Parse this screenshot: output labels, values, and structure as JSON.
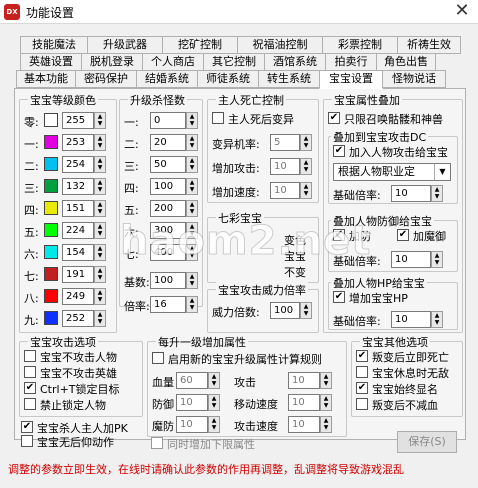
{
  "window": {
    "title": "功能设置",
    "icon_text": "DX",
    "close_glyph": "✕"
  },
  "tabs_row1": [
    "技能魔法",
    "升级武器",
    "挖矿控制",
    "祝福油控制",
    "彩票控制",
    "祈祷生效"
  ],
  "tabs_row2": [
    "英雄设置",
    "脱机登录",
    "个人商店",
    "其它控制",
    "酒馆系统",
    "拍卖行",
    "角色出售"
  ],
  "tabs_row3": [
    "基本功能",
    "密码保护",
    "结婚系统",
    "师徒系统",
    "转生系统",
    "宝宝设置",
    "怪物说话"
  ],
  "active_tab": "宝宝设置",
  "colors": {
    "title": "宝宝等级颜色",
    "rows": [
      {
        "label": "零:",
        "value": "255",
        "swatch": "#ffffff"
      },
      {
        "label": "一:",
        "value": "253",
        "swatch": "#e000e0"
      },
      {
        "label": "二:",
        "value": "254",
        "swatch": "#00c0f0"
      },
      {
        "label": "三:",
        "value": "132",
        "swatch": "#00a040"
      },
      {
        "label": "四:",
        "value": "151",
        "swatch": "#e8e800"
      },
      {
        "label": "五:",
        "value": "224",
        "swatch": "#00ff00"
      },
      {
        "label": "六:",
        "value": "154",
        "swatch": "#00e8e8"
      },
      {
        "label": "七:",
        "value": "191",
        "swatch": "#c02020"
      },
      {
        "label": "八:",
        "value": "249",
        "swatch": "#ff0000"
      },
      {
        "label": "九:",
        "value": "252",
        "swatch": "#1030ff"
      }
    ]
  },
  "upgrade": {
    "title": "升级杀怪数",
    "rows": [
      {
        "label": "一:",
        "value": "0"
      },
      {
        "label": "二:",
        "value": "20"
      },
      {
        "label": "三:",
        "value": "50"
      },
      {
        "label": "四:",
        "value": "100"
      },
      {
        "label": "五:",
        "value": "200"
      },
      {
        "label": "六:",
        "value": "300"
      },
      {
        "label": "七:",
        "value": "400"
      }
    ],
    "base_label": "基数:",
    "base_value": "100",
    "ratio_label": "倍率:",
    "ratio_value": "16"
  },
  "death": {
    "title": "主人死亡控制",
    "checkbox": "主人死后变异",
    "rate_label": "变异机率:",
    "rate_value": "5",
    "attack_label": "增加攻击:",
    "attack_value": "10",
    "speed_label": "增加速度:",
    "speed_value": "10"
  },
  "rainbow": {
    "title": "七彩宝宝",
    "line1": "变色",
    "line2": "宝宝",
    "line3": "不变"
  },
  "power": {
    "title": "宝宝攻击威力倍率",
    "label": "威力倍数:",
    "value": "100"
  },
  "attr": {
    "title": "宝宝属性叠加",
    "summon_only": "只限召唤骷髅和神兽",
    "dc": {
      "title": "叠加到宝宝攻击DC",
      "checkbox": "加入人物攻击给宝宝",
      "select": "根据人物职业定",
      "base_label": "基础倍率:",
      "base_value": "10"
    },
    "def": {
      "title": "叠加人物防御给宝宝",
      "cb1": "加防",
      "cb2": "加魔御",
      "base_label": "基础倍率:",
      "base_value": "10"
    },
    "hp": {
      "title": "叠加人物HP给宝宝",
      "checkbox": "增加宝宝HP",
      "base_label": "基础倍率:",
      "base_value": "10"
    }
  },
  "attack_opts": {
    "title": "宝宝攻击选项",
    "items": [
      {
        "label": "宝宝不攻击人物",
        "checked": false
      },
      {
        "label": "宝宝不攻击英雄",
        "checked": false
      },
      {
        "label": "Ctrl+T锁定目标",
        "checked": true
      },
      {
        "label": "禁止锁定人物",
        "checked": false
      }
    ]
  },
  "kill_master": {
    "label": "宝宝杀人主人加PK",
    "checked": true
  },
  "no_death_drop": {
    "label": "宝宝无后仰动作",
    "checked": false
  },
  "per_level": {
    "title": "每升一级增加属性",
    "enable": "启用新的宝宝升级属性计算规则",
    "hp_label": "血量",
    "hp_value": "60",
    "attack_label": "攻击",
    "attack_value": "10",
    "def_label": "防御",
    "def_value": "10",
    "move_label": "移动速度",
    "move_value": "10",
    "mdef_label": "魔防",
    "mdef_value": "10",
    "atkspeed_label": "攻击速度",
    "atkspeed_value": "10",
    "limit": "同时增加下限属性"
  },
  "other": {
    "title": "宝宝其他选项",
    "items": [
      {
        "label": "叛变后立即死亡",
        "checked": true
      },
      {
        "label": "宝宝休息时无敌",
        "checked": false
      },
      {
        "label": "宝宝始终显名",
        "checked": true
      },
      {
        "label": "叛变后不减血",
        "checked": false
      }
    ]
  },
  "save_label": "保存(S)",
  "warning": "调整的参数立即生效，在线时请确认此参数的作用再调整，乱调整将导致游戏混乱",
  "watermark": "haom2.net"
}
